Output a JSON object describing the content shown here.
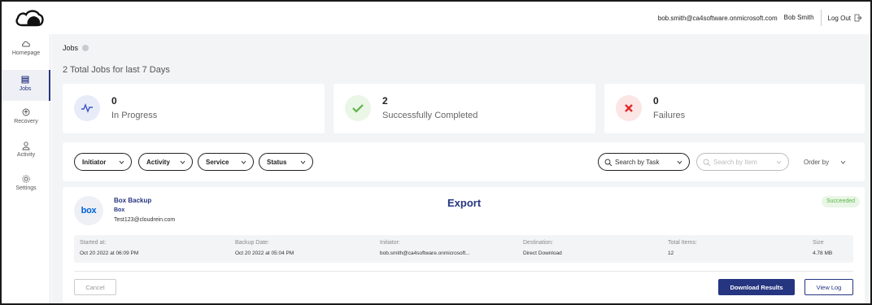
{
  "header": {
    "email": "bob.smith@ca4software.onmicrosoft.com",
    "user_name": "Bob Smith",
    "logout_label": "Log Out",
    "logo_icon": "cloud-logo-icon"
  },
  "sidebar": {
    "items": [
      {
        "label": "Homepage",
        "icon": "cloud-icon",
        "active": false
      },
      {
        "label": "Jobs",
        "icon": "jobs-icon",
        "active": true
      },
      {
        "label": "Recovery",
        "icon": "recovery-icon",
        "active": false
      },
      {
        "label": "Activity",
        "icon": "user-icon",
        "active": false
      },
      {
        "label": "Settings",
        "icon": "gear-icon",
        "active": false
      }
    ]
  },
  "page": {
    "title": "Jobs",
    "subtitle": "2 Total Jobs for last 7 Days"
  },
  "stats": [
    {
      "value": "0",
      "label": "In Progress",
      "icon": "pulse-icon",
      "color": "#3a55c9",
      "bg": "#e8ecf8"
    },
    {
      "value": "2",
      "label": "Successfully Completed",
      "icon": "check-icon",
      "color": "#5bb548",
      "bg": "#eaf6e6"
    },
    {
      "value": "0",
      "label": "Failures",
      "icon": "x-icon",
      "color": "#e02c2c",
      "bg": "#fbe5e5"
    }
  ],
  "filters": {
    "initiator": "Initiator",
    "activity": "Activity",
    "service": "Service",
    "status": "Status",
    "search_task_placeholder": "Search by Task",
    "search_item_placeholder": "Search by Item",
    "order_by": "Order by"
  },
  "job": {
    "name": "Box Backup",
    "service": "Box",
    "account": "Test123@cloudrein.com",
    "logo_text": "box",
    "type": "Export",
    "status": "Succeeded",
    "details": {
      "started_label": "Started at:",
      "started_value": "Oct 20 2022 at 06:09 PM",
      "backup_label": "Backup Date:",
      "backup_value": "Oct 20 2022 at 05:04 PM",
      "initiator_label": "Initiator:",
      "initiator_value": "bob.smith@ca4software.onmicrosoft...",
      "destination_label": "Destination:",
      "destination_value": "Direct Download",
      "items_label": "Total Items:",
      "items_value": "12",
      "size_label": "Size",
      "size_value": "4.78 MB"
    },
    "cancel_label": "Cancel",
    "download_label": "Download Results",
    "view_log_label": "View Log"
  }
}
